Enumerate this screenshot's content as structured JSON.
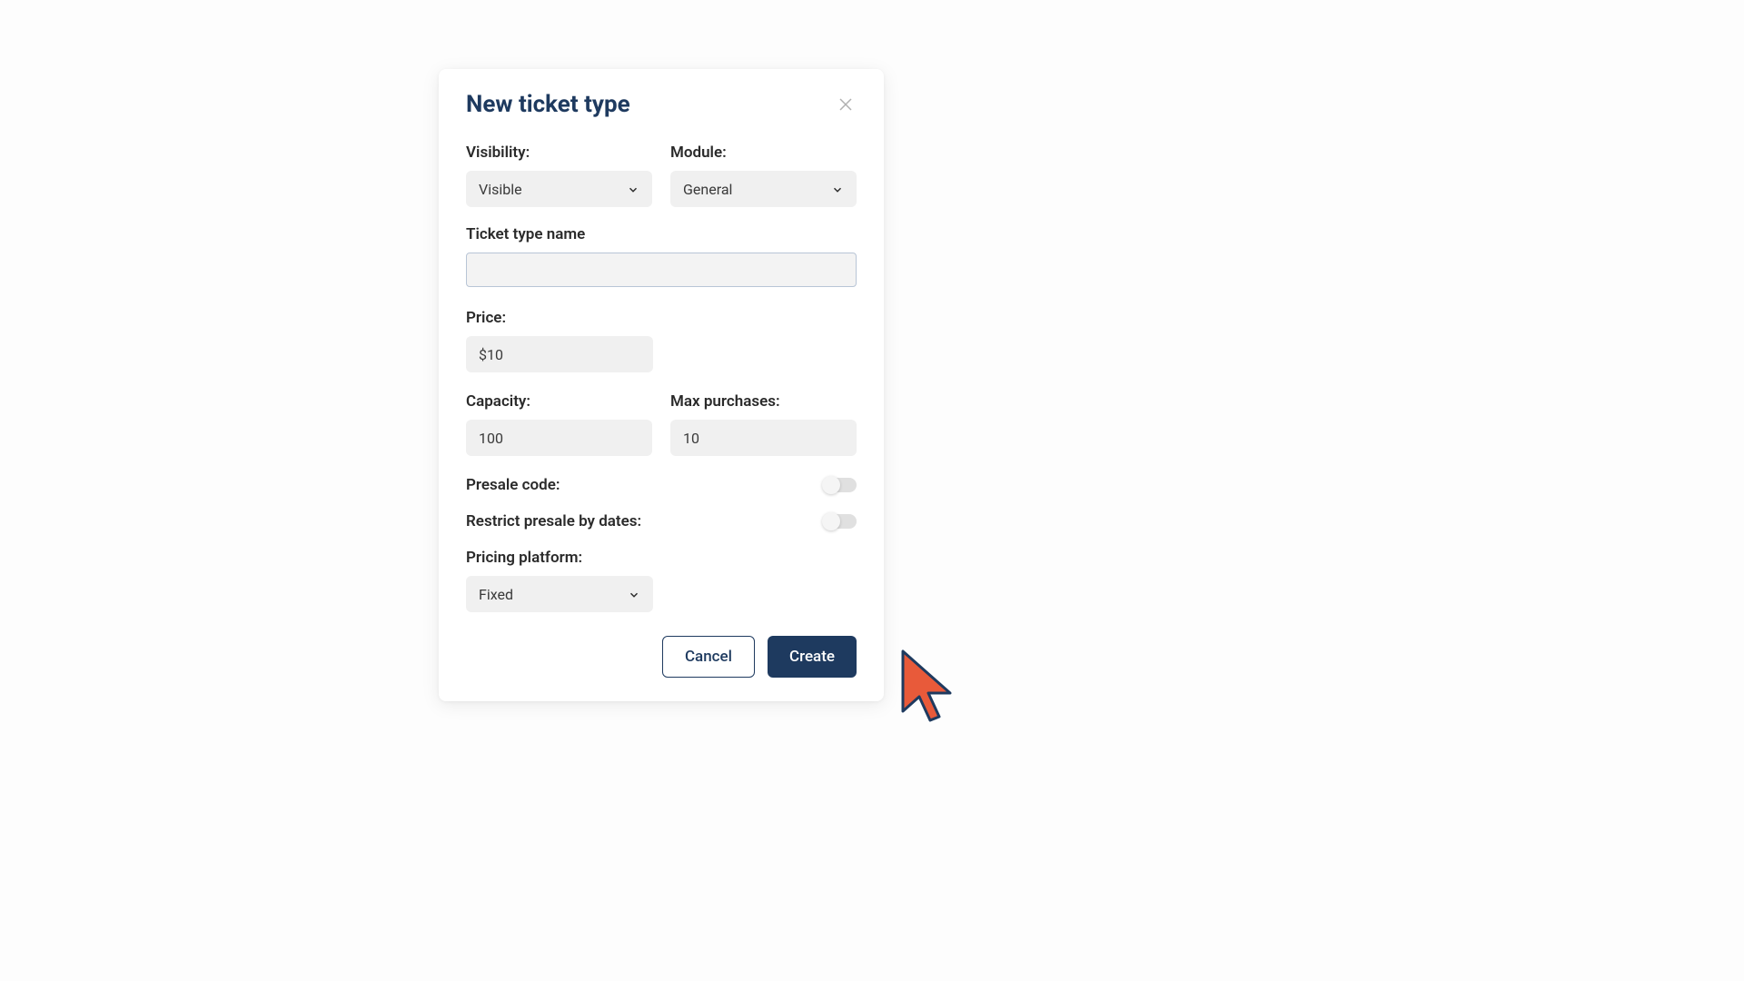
{
  "modal": {
    "title": "New ticket type",
    "fields": {
      "visibility": {
        "label": "Visibility:",
        "value": "Visible"
      },
      "module": {
        "label": "Module:",
        "value": "General"
      },
      "ticketTypeName": {
        "label": "Ticket type name",
        "value": ""
      },
      "price": {
        "label": "Price:",
        "value": "$10"
      },
      "capacity": {
        "label": "Capacity:",
        "value": "100"
      },
      "maxPurchases": {
        "label": "Max purchases:",
        "value": "10"
      },
      "presaleCode": {
        "label": "Presale code:",
        "enabled": false
      },
      "restrictPresaleDates": {
        "label": "Restrict presale by dates:",
        "enabled": false
      },
      "pricingPlatform": {
        "label": "Pricing platform:",
        "value": "Fixed"
      }
    },
    "actions": {
      "cancel": "Cancel",
      "create": "Create"
    }
  }
}
